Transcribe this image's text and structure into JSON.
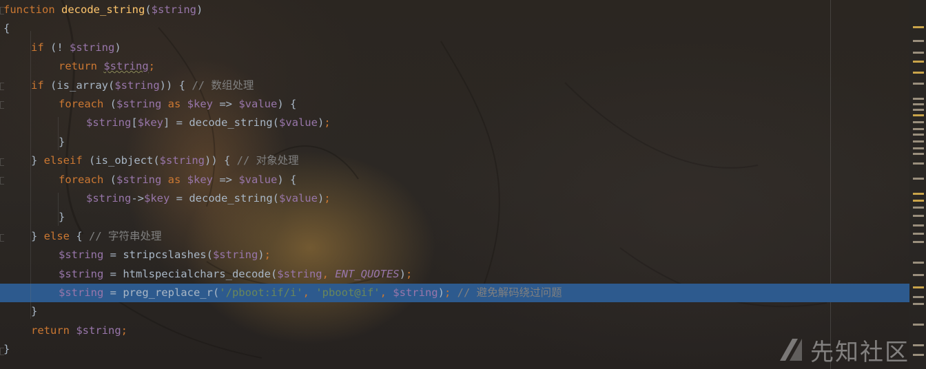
{
  "editor": {
    "lines": [
      [
        {
          "t": "kw",
          "v": "function "
        },
        {
          "t": "fn",
          "v": "decode_string"
        },
        {
          "t": "plain",
          "v": "("
        },
        {
          "t": "var",
          "v": "$string"
        },
        {
          "t": "plain",
          "v": ")"
        }
      ],
      [
        {
          "t": "plain",
          "v": "{"
        }
      ],
      [
        {
          "t": "kw",
          "v": "if "
        },
        {
          "t": "plain",
          "v": "(! "
        },
        {
          "t": "var",
          "v": "$string"
        },
        {
          "t": "plain",
          "v": ")"
        }
      ],
      [
        {
          "t": "kw",
          "v": "return "
        },
        {
          "t": "var squig",
          "v": "$string"
        },
        {
          "t": "kw",
          "v": ";"
        }
      ],
      [
        {
          "t": "kw",
          "v": "if "
        },
        {
          "t": "plain",
          "v": "(is_array("
        },
        {
          "t": "var",
          "v": "$string"
        },
        {
          "t": "plain",
          "v": ")) { "
        },
        {
          "t": "cmt",
          "v": "// "
        },
        {
          "t": "cmt cmt-cjk",
          "v": "数组处理"
        }
      ],
      [
        {
          "t": "kw",
          "v": "foreach "
        },
        {
          "t": "plain",
          "v": "("
        },
        {
          "t": "var",
          "v": "$string "
        },
        {
          "t": "kw",
          "v": "as "
        },
        {
          "t": "var",
          "v": "$key "
        },
        {
          "t": "plain",
          "v": "=> "
        },
        {
          "t": "var",
          "v": "$value"
        },
        {
          "t": "plain",
          "v": ") {"
        }
      ],
      [
        {
          "t": "var",
          "v": "$string"
        },
        {
          "t": "plain",
          "v": "["
        },
        {
          "t": "var",
          "v": "$key"
        },
        {
          "t": "plain",
          "v": "] = decode_string("
        },
        {
          "t": "var",
          "v": "$value"
        },
        {
          "t": "plain",
          "v": ")"
        },
        {
          "t": "kw",
          "v": ";"
        }
      ],
      [
        {
          "t": "plain",
          "v": "}"
        }
      ],
      [
        {
          "t": "plain",
          "v": "} "
        },
        {
          "t": "kw",
          "v": "elseif "
        },
        {
          "t": "plain",
          "v": "(is_object("
        },
        {
          "t": "var",
          "v": "$string"
        },
        {
          "t": "plain",
          "v": ")) { "
        },
        {
          "t": "cmt",
          "v": "// "
        },
        {
          "t": "cmt cmt-cjk",
          "v": "对象处理"
        }
      ],
      [
        {
          "t": "kw",
          "v": "foreach "
        },
        {
          "t": "plain",
          "v": "("
        },
        {
          "t": "var",
          "v": "$string "
        },
        {
          "t": "kw",
          "v": "as "
        },
        {
          "t": "var",
          "v": "$key "
        },
        {
          "t": "plain",
          "v": "=> "
        },
        {
          "t": "var",
          "v": "$value"
        },
        {
          "t": "plain",
          "v": ") {"
        }
      ],
      [
        {
          "t": "var",
          "v": "$string"
        },
        {
          "t": "plain",
          "v": "->"
        },
        {
          "t": "var",
          "v": "$key "
        },
        {
          "t": "plain",
          "v": "= decode_string("
        },
        {
          "t": "var",
          "v": "$value"
        },
        {
          "t": "plain",
          "v": ")"
        },
        {
          "t": "kw",
          "v": ";"
        }
      ],
      [
        {
          "t": "plain",
          "v": "}"
        }
      ],
      [
        {
          "t": "plain",
          "v": "} "
        },
        {
          "t": "kw",
          "v": "else "
        },
        {
          "t": "plain",
          "v": "{ "
        },
        {
          "t": "cmt",
          "v": "// "
        },
        {
          "t": "cmt cmt-cjk",
          "v": "字符串处理"
        }
      ],
      [
        {
          "t": "var",
          "v": "$string "
        },
        {
          "t": "plain",
          "v": "= stripcslashes("
        },
        {
          "t": "var",
          "v": "$string"
        },
        {
          "t": "plain",
          "v": ")"
        },
        {
          "t": "kw",
          "v": ";"
        }
      ],
      [
        {
          "t": "var",
          "v": "$string "
        },
        {
          "t": "plain",
          "v": "= htmlspecialchars_decode("
        },
        {
          "t": "var",
          "v": "$string"
        },
        {
          "t": "kw",
          "v": ", "
        },
        {
          "t": "const",
          "v": "ENT_QUOTES"
        },
        {
          "t": "plain",
          "v": ")"
        },
        {
          "t": "kw",
          "v": ";"
        }
      ],
      [
        {
          "t": "var",
          "v": "$string "
        },
        {
          "t": "plain",
          "v": "= preg_replace_r("
        },
        {
          "t": "str",
          "v": "'/pboot:if/i'"
        },
        {
          "t": "kw",
          "v": ", "
        },
        {
          "t": "str",
          "v": "'pboot@if'"
        },
        {
          "t": "kw",
          "v": ", "
        },
        {
          "t": "var",
          "v": "$string"
        },
        {
          "t": "plain",
          "v": ")"
        },
        {
          "t": "kw",
          "v": "; "
        },
        {
          "t": "cmt",
          "v": "// "
        },
        {
          "t": "cmt cmt-cjk",
          "v": "避免解码绕过问题"
        }
      ],
      [
        {
          "t": "plain",
          "v": "}"
        }
      ],
      [
        {
          "t": "kw",
          "v": "return "
        },
        {
          "t": "var",
          "v": "$string"
        },
        {
          "t": "kw",
          "v": ";"
        }
      ],
      [
        {
          "t": "plain",
          "v": "}"
        }
      ]
    ],
    "highlighted_line_index": 15
  },
  "watermark": {
    "text": "先知社区"
  },
  "colors": {
    "keyword": "#cc7832",
    "function": "#ffc66d",
    "variable": "#9876aa",
    "string": "#6a8759",
    "comment": "#808080",
    "selection": "#2d5a8e"
  }
}
